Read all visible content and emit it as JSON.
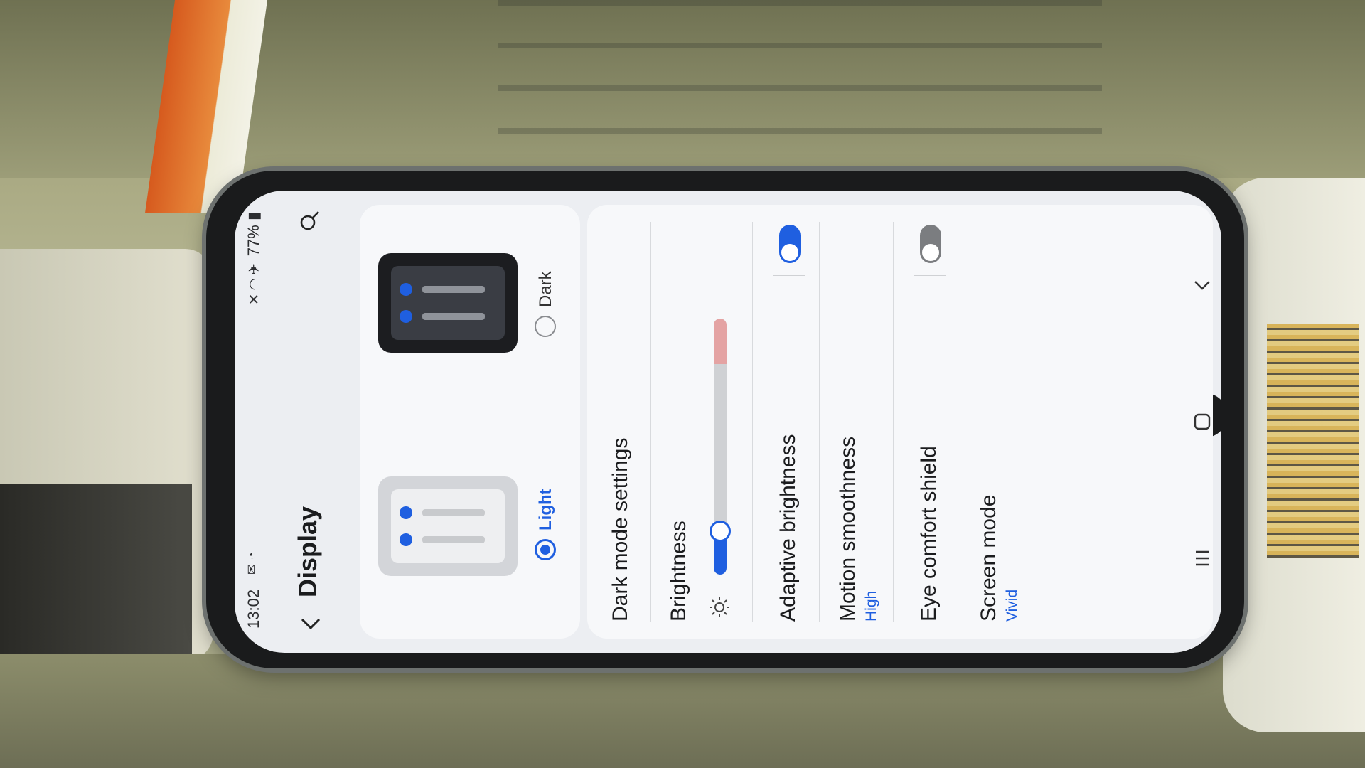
{
  "status_bar": {
    "time": "13:02",
    "left_icons": [
      "message-icon",
      "whatsapp-icon"
    ],
    "right_icons": [
      "mute-icon",
      "wifi-icon",
      "airplane-icon",
      "battery-icon"
    ],
    "battery": "77%"
  },
  "app_bar": {
    "title": "Display"
  },
  "mode": {
    "light_label": "Light",
    "dark_label": "Dark",
    "selected": "Light",
    "accent": "#1f5fe0"
  },
  "settings": {
    "dark_mode_settings": "Dark mode settings",
    "brightness_title": "Brightness",
    "brightness_level": 0.17,
    "adaptive_brightness": {
      "title": "Adaptive brightness",
      "on": true
    },
    "motion_smoothness": {
      "title": "Motion smoothness",
      "value": "High"
    },
    "eye_comfort_shield": {
      "title": "Eye comfort shield",
      "on": false
    },
    "screen_mode": {
      "title": "Screen mode",
      "value": "Vivid"
    }
  },
  "nav_bar": {
    "recents": "recents-icon",
    "home": "home-icon",
    "back": "back-icon"
  }
}
